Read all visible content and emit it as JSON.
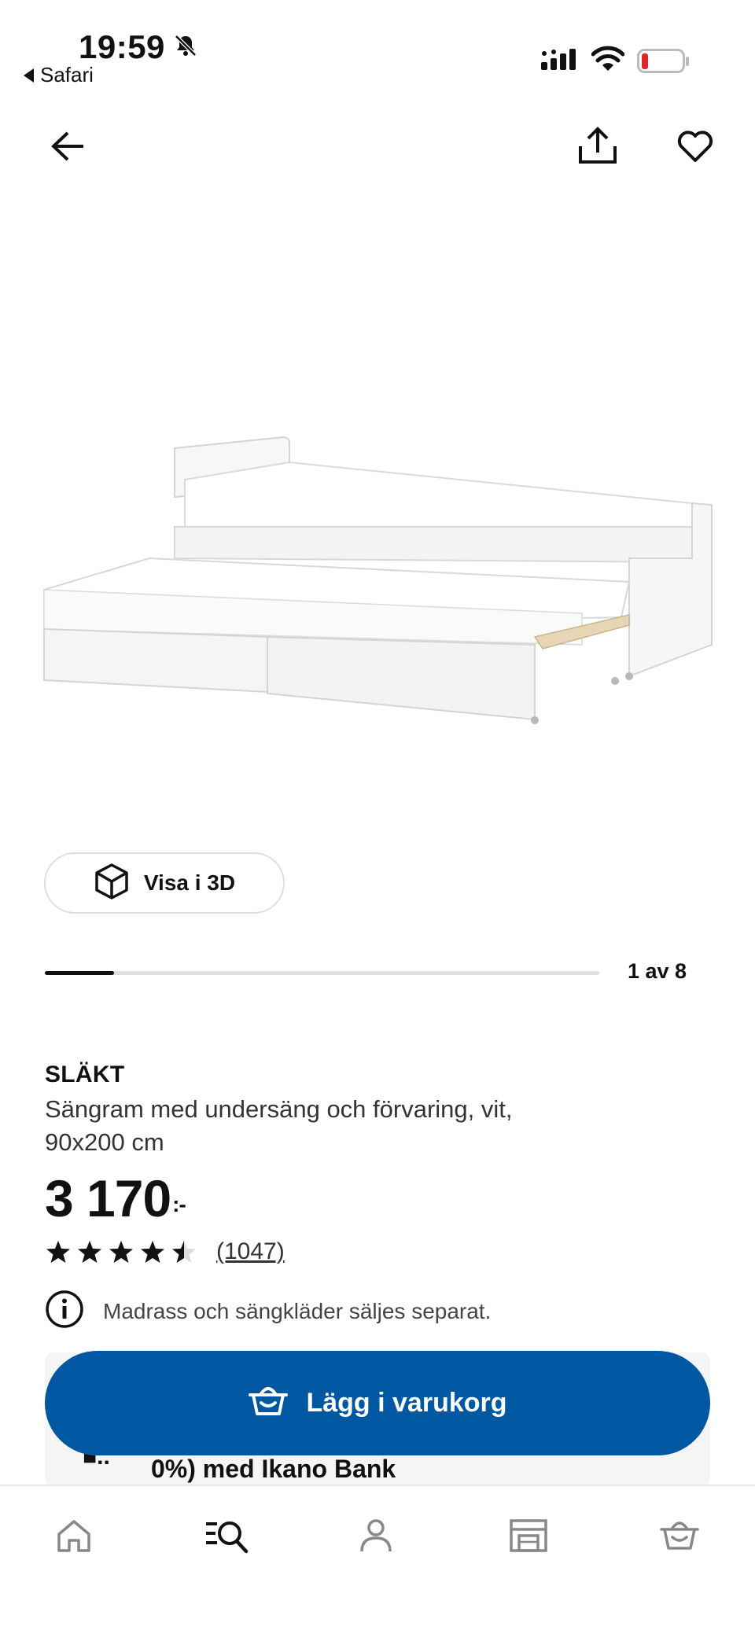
{
  "status_bar": {
    "time": "19:59",
    "back_app": "Safari"
  },
  "gallery": {
    "position_label": "1 av 8",
    "progress_fraction": 0.125
  },
  "view_3d": {
    "label": "Visa i 3D"
  },
  "product": {
    "brand": "SLÄKT",
    "description": "Sängram med undersäng och förvaring, vit, 90x200 cm",
    "price": "3 170",
    "price_suffix": ":-",
    "rating_value": 4.5,
    "rating_count": "(1047)",
    "notice": "Madrass och sängkläder säljes separat."
  },
  "finance": {
    "text": "0%) med Ikano Bank"
  },
  "cart": {
    "label": "Lägg i varukorg"
  },
  "colors": {
    "primary": "#0058a3",
    "battery_low": "#e0252b"
  },
  "icons": {
    "back": "arrow-left-icon",
    "share": "share-icon",
    "favourite": "heart-icon",
    "view3d": "cube-icon",
    "info": "info-icon",
    "cart": "basket-icon"
  },
  "tab_bar": {
    "items": [
      "home",
      "search",
      "profile",
      "store",
      "cart"
    ],
    "active": "search"
  }
}
